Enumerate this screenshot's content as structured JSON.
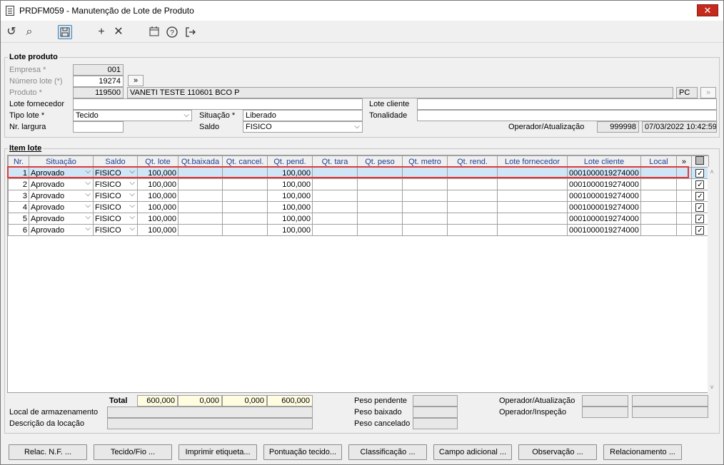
{
  "window": {
    "title": "PRDFM059 - Manutenção de Lote de Produto",
    "close": "✕"
  },
  "toolbar": {
    "icons": [
      "undo-icon",
      "search-icon",
      "save-icon",
      "add-icon",
      "delete-icon",
      "calendar-icon",
      "help-icon",
      "exit-icon"
    ]
  },
  "lote": {
    "group_title": "Lote produto",
    "empresa_label": "Empresa *",
    "empresa": "001",
    "numero_label": "Número lote (*)",
    "numero": "19274",
    "more_label": "»",
    "produto_label": "Produto *",
    "produto_code": "119500",
    "produto_desc": "VANETI TESTE 110601 BCO P",
    "unit": "PC",
    "lote_fornecedor_label": "Lote fornecedor",
    "lote_fornecedor": "",
    "lote_cliente_label": "Lote cliente",
    "lote_cliente": "",
    "tipo_label": "Tipo lote *",
    "tipo": "Tecido",
    "situacao_label": "Situação *",
    "situacao": "Liberado",
    "tonalidade_label": "Tonalidade",
    "tonalidade": "",
    "largura_label": "Nr. largura",
    "largura": "",
    "saldo_label": "Saldo",
    "saldo": "FISICO",
    "operador_label": "Operador/Atualização",
    "operador": "999998",
    "data_atualizacao": "07/03/2022 10:42:59"
  },
  "items": {
    "group_title": "Item lote",
    "columns": [
      "Nr.",
      "Situação",
      "Saldo",
      "Qt. lote",
      "Qt.baixada",
      "Qt. cancel.",
      "Qt. pend.",
      "Qt. tara",
      "Qt. peso",
      "Qt. metro",
      "Qt. rend.",
      "Lote fornecedor",
      "Lote cliente",
      "Local",
      "»",
      ""
    ],
    "rows": [
      {
        "nr": "1",
        "situacao": "Aprovado",
        "saldo": "FISICO",
        "qt_lote": "100,000",
        "qt_baixada": "",
        "qt_cancel": "",
        "qt_pend": "100,000",
        "lote_cliente": "0001000019274000",
        "check": "✓"
      },
      {
        "nr": "2",
        "situacao": "Aprovado",
        "saldo": "FISICO",
        "qt_lote": "100,000",
        "qt_baixada": "",
        "qt_cancel": "",
        "qt_pend": "100,000",
        "lote_cliente": "0001000019274000",
        "check": "✓"
      },
      {
        "nr": "3",
        "situacao": "Aprovado",
        "saldo": "FISICO",
        "qt_lote": "100,000",
        "qt_baixada": "",
        "qt_cancel": "",
        "qt_pend": "100,000",
        "lote_cliente": "0001000019274000",
        "check": "✓"
      },
      {
        "nr": "4",
        "situacao": "Aprovado",
        "saldo": "FISICO",
        "qt_lote": "100,000",
        "qt_baixada": "",
        "qt_cancel": "",
        "qt_pend": "100,000",
        "lote_cliente": "0001000019274000",
        "check": "✓"
      },
      {
        "nr": "5",
        "situacao": "Aprovado",
        "saldo": "FISICO",
        "qt_lote": "100,000",
        "qt_baixada": "",
        "qt_cancel": "",
        "qt_pend": "100,000",
        "lote_cliente": "0001000019274000",
        "check": "✓"
      },
      {
        "nr": "6",
        "situacao": "Aprovado",
        "saldo": "FISICO",
        "qt_lote": "100,000",
        "qt_baixada": "",
        "qt_cancel": "",
        "qt_pend": "100,000",
        "lote_cliente": "0001000019274000",
        "check": "✓"
      }
    ],
    "total_label": "Total",
    "totals": {
      "qt_lote": "600,000",
      "qt_baixada": "0,000",
      "qt_cancel": "0,000",
      "qt_pend": "600,000"
    },
    "local_label": "Local de armazenamento",
    "descricao_label": "Descrição da locação",
    "peso_pendente_label": "Peso pendente",
    "peso_baixado_label": "Peso baixado",
    "peso_cancelado_label": "Peso cancelado",
    "operador_atualizacao_label": "Operador/Atualização",
    "operador_inspecao_label": "Operador/Inspeção"
  },
  "buttons": [
    "Relac. N.F. ...",
    "Tecido/Fio ...",
    "Imprimir etiqueta...",
    "Pontuação tecido...",
    "Classificação ...",
    "Campo adicional ...",
    "Observação ...",
    "Relacionamento ..."
  ]
}
